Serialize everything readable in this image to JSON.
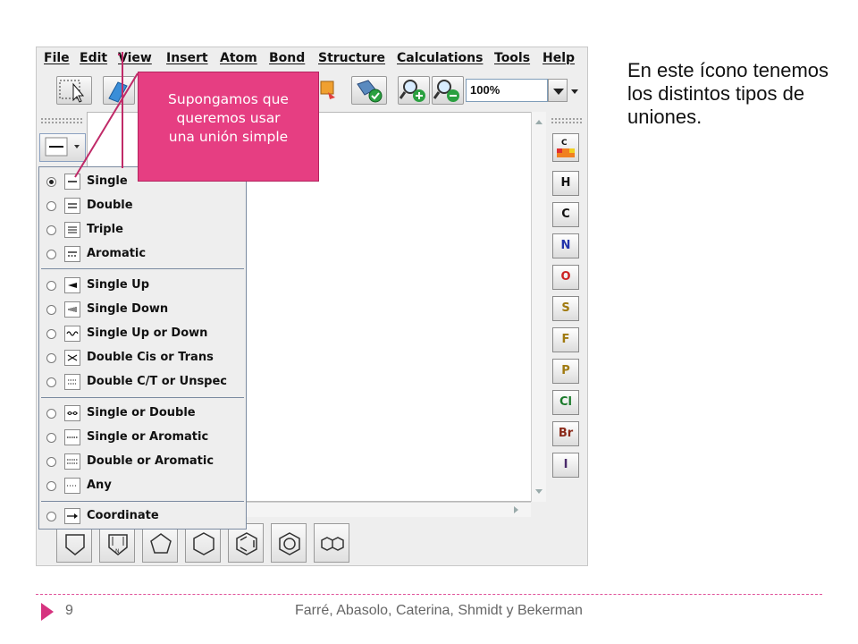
{
  "menu": [
    "File",
    "Edit",
    "View",
    "Insert",
    "Atom",
    "Bond",
    "Structure",
    "Calculations",
    "Tools",
    "Help"
  ],
  "toolbar": {
    "zoom_value": "100%"
  },
  "bond_menu": {
    "groups": [
      [
        "Single",
        "Double",
        "Triple",
        "Aromatic"
      ],
      [
        "Single Up",
        "Single Down",
        "Single Up or Down",
        "Double Cis or Trans",
        "Double C/T or Unspec"
      ],
      [
        "Single or Double",
        "Single or Aromatic",
        "Double or Aromatic",
        "Any"
      ],
      [
        "Coordinate"
      ]
    ],
    "selected": "Single"
  },
  "atom_panel": [
    "H",
    "C",
    "N",
    "O",
    "S",
    "F",
    "P",
    "Cl",
    "Br",
    "I"
  ],
  "atom_colors": {
    "H": "#111111",
    "C": "#111111",
    "N": "#2233aa",
    "O": "#cc2222",
    "S": "#a07a10",
    "F": "#a07a10",
    "P": "#a07a10",
    "Cl": "#1a7a2a",
    "Br": "#8a2a1a",
    "I": "#4a2a6a"
  },
  "callout": {
    "line1": "Supongamos que",
    "line2": "queremos usar",
    "line3": "una unión simple"
  },
  "note": {
    "text": "En este ícono tenemos los distintos tipos de uniones."
  },
  "footer": {
    "page": "9",
    "authors": "Farré, Abasolo, Caterina, Shmidt y Bekerman"
  },
  "colors": {
    "accent": "#e63e82"
  }
}
